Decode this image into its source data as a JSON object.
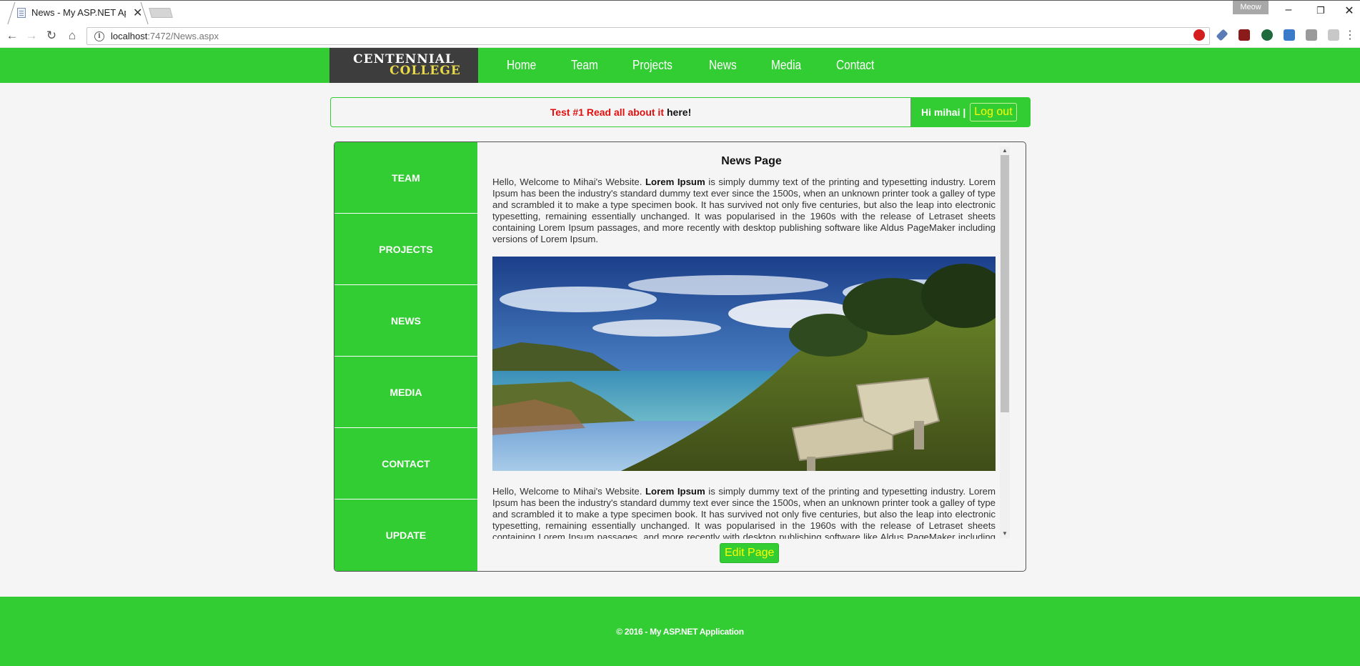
{
  "browser": {
    "tab_title": "News - My ASP.NET App",
    "profile_name": "Meow",
    "url_host": "localhost",
    "url_path": ":7472/News.aspx"
  },
  "site": {
    "logo_top": "CENTENNIAL",
    "logo_bottom": "COLLEGE",
    "topnav": [
      "Home",
      "Team",
      "Projects",
      "News",
      "Media",
      "Contact"
    ]
  },
  "announcement": {
    "highlight": "Test #1 Read all about it",
    "rest": "here!",
    "greeting": "Hi mihai |",
    "logout_label": "Log out"
  },
  "sidebar": {
    "items": [
      "TEAM",
      "PROJECTS",
      "NEWS",
      "MEDIA",
      "CONTACT",
      "UPDATE"
    ]
  },
  "main": {
    "heading": "News Page",
    "para_intro": "Hello, Welcome to Mihai's Website.",
    "para_bold": "Lorem Ipsum",
    "para_body": "is simply dummy text of the printing and typesetting industry. Lorem Ipsum has been the industry's standard dummy text ever since the 1500s, when an unknown printer took a galley of type and scrambled it to make a type specimen book. It has survived not only five centuries, but also the leap into electronic typesetting, remaining essentially unchanged. It was popularised in the 1960s with the release of Letraset sheets containing Lorem Ipsum passages, and more recently with desktop publishing software like Aldus PageMaker including versions of Lorem Ipsum.",
    "edit_label": "Edit Page"
  },
  "footer": {
    "text": "© 2016 - My ASP.NET Application"
  },
  "colors": {
    "accent_green": "#32cd32",
    "link_yellow": "#ffff00",
    "announce_red": "#e01010"
  },
  "icons": [
    "back-icon",
    "forward-icon",
    "reload-icon",
    "home-icon",
    "info-icon",
    "star-icon",
    "minimize-icon",
    "restore-icon",
    "close-icon"
  ]
}
